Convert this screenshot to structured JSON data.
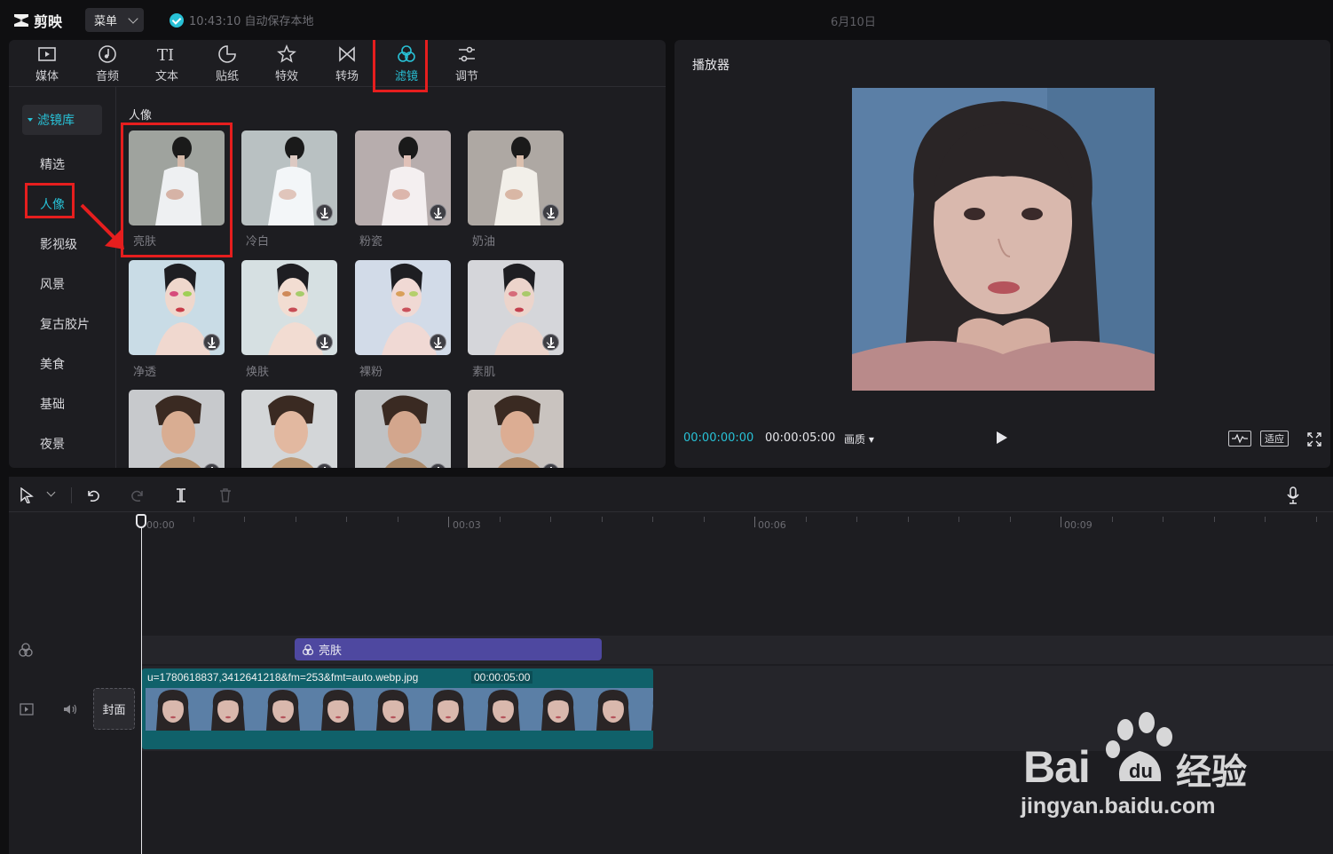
{
  "app": {
    "name": "剪映",
    "menu_label": "菜单",
    "autosave_text": "10:43:10 自动保存本地",
    "date": "6月10日"
  },
  "tabs": [
    {
      "label": "媒体",
      "icon": "media-icon"
    },
    {
      "label": "音频",
      "icon": "audio-icon"
    },
    {
      "label": "文本",
      "icon": "text-icon"
    },
    {
      "label": "贴纸",
      "icon": "sticker-icon"
    },
    {
      "label": "特效",
      "icon": "effects-icon"
    },
    {
      "label": "转场",
      "icon": "transition-icon"
    },
    {
      "label": "滤镜",
      "icon": "filter-icon",
      "active": true
    },
    {
      "label": "调节",
      "icon": "adjust-icon"
    }
  ],
  "sidebar": {
    "library_label": "滤镜库",
    "items": [
      {
        "label": "精选"
      },
      {
        "label": "人像",
        "active": true
      },
      {
        "label": "影视级"
      },
      {
        "label": "风景"
      },
      {
        "label": "复古胶片"
      },
      {
        "label": "美食"
      },
      {
        "label": "基础"
      },
      {
        "label": "夜景"
      }
    ]
  },
  "filters": {
    "section_title": "人像",
    "items": [
      {
        "label": "亮肤",
        "downloaded": true
      },
      {
        "label": "冷白",
        "downloaded": false
      },
      {
        "label": "粉瓷",
        "downloaded": false
      },
      {
        "label": "奶油",
        "downloaded": false
      },
      {
        "label": "净透",
        "downloaded": false
      },
      {
        "label": "焕肤",
        "downloaded": false
      },
      {
        "label": "裸粉",
        "downloaded": false
      },
      {
        "label": "素肌",
        "downloaded": false
      }
    ]
  },
  "player": {
    "title": "播放器",
    "current_time": "00:00:00:00",
    "total_time": "00:00:05:00",
    "quality_label": "画质",
    "fit_label": "适应"
  },
  "timeline": {
    "ruler_labels": [
      "00:00",
      "00:03",
      "00:06",
      "00:09"
    ],
    "filter_clip_label": "亮肤",
    "video_clip_name": "u=1780618837,3412641218&fm=253&fmt=auto.webp.jpg",
    "video_clip_duration": "00:00:05:00",
    "cover_label": "封面"
  },
  "watermark": {
    "brand": "Bai",
    "brand_cn": "经验",
    "url": "jingyan.baidu.com"
  },
  "colors": {
    "accent": "#28c1d6",
    "highlight": "#e61e1e",
    "filter_clip": "#4e48a0",
    "video_clip": "#10616a"
  }
}
